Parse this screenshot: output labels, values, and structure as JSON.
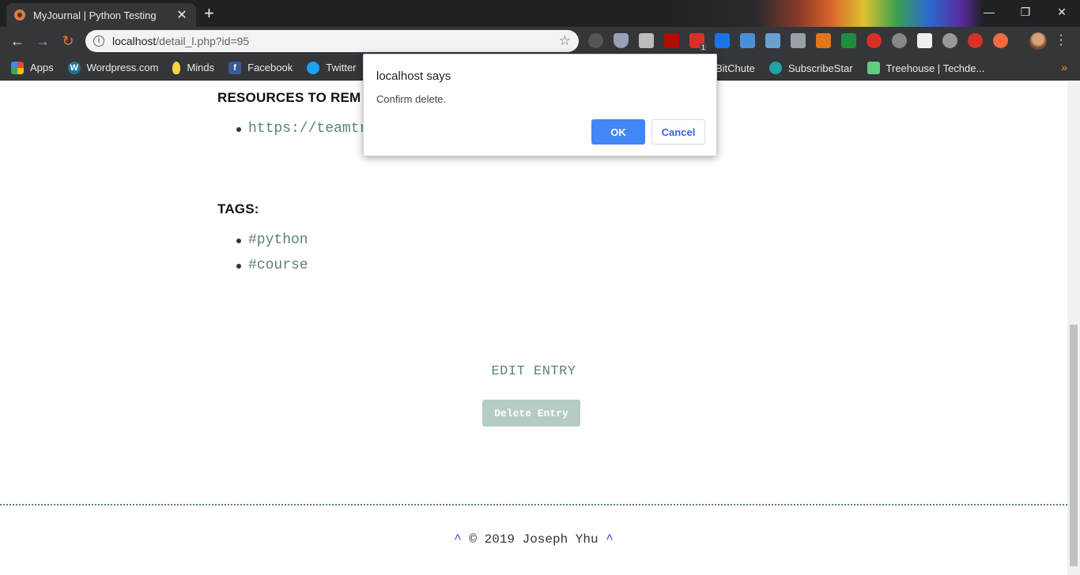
{
  "browser": {
    "tab_title": "MyJournal | Python Testing",
    "tab_close": "✕",
    "new_tab": "+",
    "window_controls": {
      "minimize": "—",
      "restore": "❐",
      "close": "✕"
    },
    "url_host": "localhost",
    "url_path": "/detail_l.php?id=95",
    "bookmarks": [
      {
        "label": "Apps",
        "icon": "apps-icon",
        "color": "#e8453c"
      },
      {
        "label": "Wordpress.com",
        "icon": "wordpress-icon",
        "color": "#21759b"
      },
      {
        "label": "Minds",
        "icon": "minds-icon",
        "color": "#f5d547"
      },
      {
        "label": "Facebook",
        "icon": "facebook-icon",
        "color": "#3b5998"
      },
      {
        "label": "Twitter",
        "icon": "twitter-icon",
        "color": "#1da1f2"
      }
    ],
    "bookmarks_right": [
      {
        "label": "BitChute",
        "icon": "bitchute-icon",
        "color": "#ef4137"
      },
      {
        "label": "SubscribeStar",
        "icon": "subscribestar-icon",
        "color": "#1ea4a4"
      },
      {
        "label": "Treehouse | Techde...",
        "icon": "treehouse-icon",
        "color": "#5fcf80"
      }
    ],
    "extension_badge": "1"
  },
  "page": {
    "resources_heading": "RESOURCES TO REM",
    "resources": [
      "https://teamtr"
    ],
    "tags_heading": "TAGS:",
    "tags": [
      "#python",
      "#course"
    ],
    "edit_link": "EDIT ENTRY",
    "delete_button": "Delete Entry",
    "footer_caret_left": "^",
    "footer_text": " © 2019 Joseph Yhu ",
    "footer_caret_right": "^"
  },
  "dialog": {
    "title": "localhost says",
    "message": "Confirm delete.",
    "ok_label": "OK",
    "cancel_label": "Cancel"
  },
  "colors": {
    "accent_green": "#5b8275",
    "delete_button_bg": "#b5cbc6",
    "dialog_ok": "#4285f4"
  }
}
